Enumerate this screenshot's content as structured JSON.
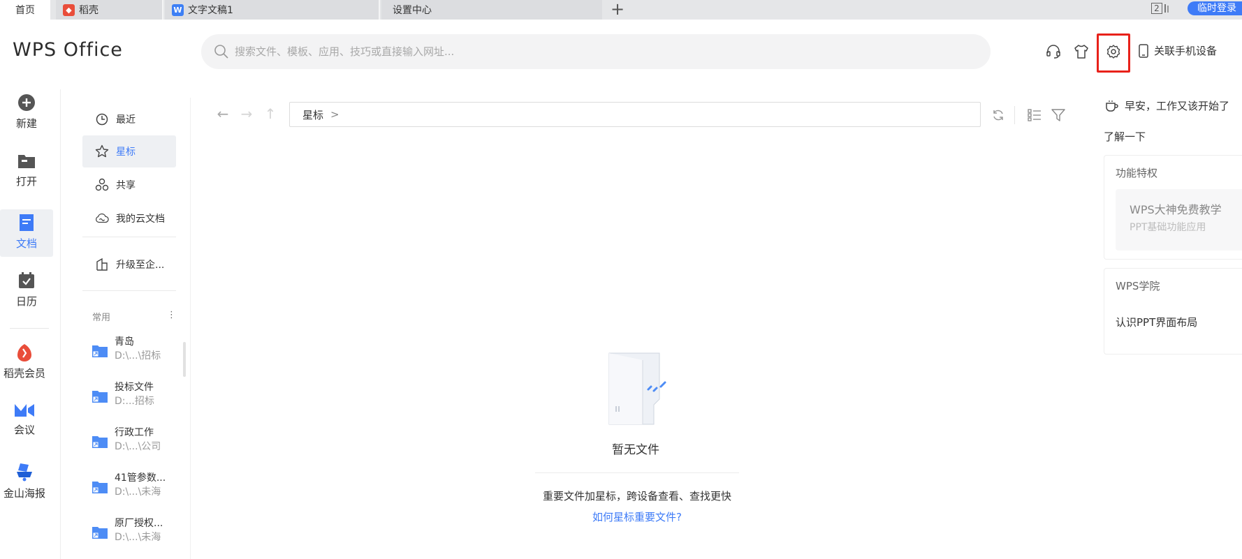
{
  "tabs": {
    "home": "首页",
    "docer": "稻壳",
    "doc": "文字文稿1",
    "settings": "设置中心",
    "add": "+",
    "window_count": "2",
    "login": "临时登录"
  },
  "header": {
    "logo": "WPS Office",
    "search_placeholder": "搜索文件、模板、应用、技巧或直接输入网址...",
    "phone_link": "关联手机设备"
  },
  "leftnav": {
    "new": "新建",
    "open": "打开",
    "docs": "文档",
    "calendar": "日历",
    "docer_vip": "稻壳会员",
    "meeting": "会议",
    "poster": "金山海报"
  },
  "subnav": {
    "recent": "最近",
    "star": "星标",
    "share": "共享",
    "cloud": "我的云文档",
    "upgrade": "升级至企...",
    "group_title": "常用",
    "group_more": "⋮",
    "folders": [
      {
        "name": "青岛",
        "path": "D:\\...\\招标"
      },
      {
        "name": "投标文件",
        "path": "D:...招标"
      },
      {
        "name": "行政工作",
        "path": "D:\\...\\公司"
      },
      {
        "name": "41管参数...",
        "path": "D:\\...\\未海"
      },
      {
        "name": "原厂授权...",
        "path": "D:\\...\\未海"
      }
    ]
  },
  "main": {
    "back": "←",
    "forward": "→",
    "up": "↑",
    "path": "星标",
    "path_chevron": ">",
    "empty_title": "暂无文件",
    "empty_desc": "重要文件加星标，跨设备查看、查找更快",
    "empty_link": "如何星标重要文件?"
  },
  "right": {
    "greeting": "早安，工作又该开始了",
    "learn": "了解一下",
    "card1_title": "功能特权",
    "card1_item_title": "WPS大神免费教学",
    "card1_item_sub": "PPT基础功能应用",
    "card2_title": "WPS学院",
    "card2_item": "认识PPT界面布局"
  },
  "colors": {
    "accent": "#3e7bf7",
    "highlight": "#e8211a",
    "docer": "#e94d3a"
  }
}
